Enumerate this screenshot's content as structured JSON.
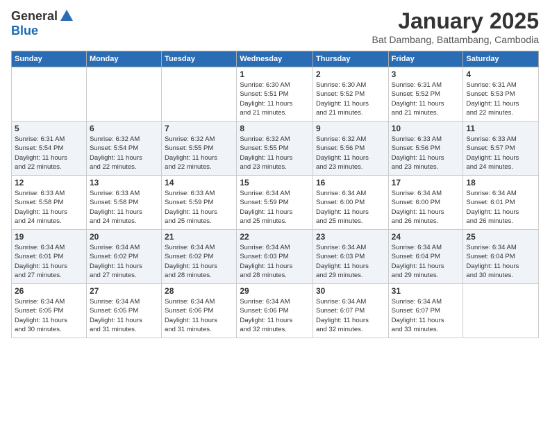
{
  "header": {
    "logo_general": "General",
    "logo_blue": "Blue",
    "month_title": "January 2025",
    "location": "Bat Dambang, Battambang, Cambodia"
  },
  "weekdays": [
    "Sunday",
    "Monday",
    "Tuesday",
    "Wednesday",
    "Thursday",
    "Friday",
    "Saturday"
  ],
  "weeks": [
    [
      {
        "day": "",
        "info": ""
      },
      {
        "day": "",
        "info": ""
      },
      {
        "day": "",
        "info": ""
      },
      {
        "day": "1",
        "info": "Sunrise: 6:30 AM\nSunset: 5:51 PM\nDaylight: 11 hours\nand 21 minutes."
      },
      {
        "day": "2",
        "info": "Sunrise: 6:30 AM\nSunset: 5:52 PM\nDaylight: 11 hours\nand 21 minutes."
      },
      {
        "day": "3",
        "info": "Sunrise: 6:31 AM\nSunset: 5:52 PM\nDaylight: 11 hours\nand 21 minutes."
      },
      {
        "day": "4",
        "info": "Sunrise: 6:31 AM\nSunset: 5:53 PM\nDaylight: 11 hours\nand 22 minutes."
      }
    ],
    [
      {
        "day": "5",
        "info": "Sunrise: 6:31 AM\nSunset: 5:54 PM\nDaylight: 11 hours\nand 22 minutes."
      },
      {
        "day": "6",
        "info": "Sunrise: 6:32 AM\nSunset: 5:54 PM\nDaylight: 11 hours\nand 22 minutes."
      },
      {
        "day": "7",
        "info": "Sunrise: 6:32 AM\nSunset: 5:55 PM\nDaylight: 11 hours\nand 22 minutes."
      },
      {
        "day": "8",
        "info": "Sunrise: 6:32 AM\nSunset: 5:55 PM\nDaylight: 11 hours\nand 23 minutes."
      },
      {
        "day": "9",
        "info": "Sunrise: 6:32 AM\nSunset: 5:56 PM\nDaylight: 11 hours\nand 23 minutes."
      },
      {
        "day": "10",
        "info": "Sunrise: 6:33 AM\nSunset: 5:56 PM\nDaylight: 11 hours\nand 23 minutes."
      },
      {
        "day": "11",
        "info": "Sunrise: 6:33 AM\nSunset: 5:57 PM\nDaylight: 11 hours\nand 24 minutes."
      }
    ],
    [
      {
        "day": "12",
        "info": "Sunrise: 6:33 AM\nSunset: 5:58 PM\nDaylight: 11 hours\nand 24 minutes."
      },
      {
        "day": "13",
        "info": "Sunrise: 6:33 AM\nSunset: 5:58 PM\nDaylight: 11 hours\nand 24 minutes."
      },
      {
        "day": "14",
        "info": "Sunrise: 6:33 AM\nSunset: 5:59 PM\nDaylight: 11 hours\nand 25 minutes."
      },
      {
        "day": "15",
        "info": "Sunrise: 6:34 AM\nSunset: 5:59 PM\nDaylight: 11 hours\nand 25 minutes."
      },
      {
        "day": "16",
        "info": "Sunrise: 6:34 AM\nSunset: 6:00 PM\nDaylight: 11 hours\nand 25 minutes."
      },
      {
        "day": "17",
        "info": "Sunrise: 6:34 AM\nSunset: 6:00 PM\nDaylight: 11 hours\nand 26 minutes."
      },
      {
        "day": "18",
        "info": "Sunrise: 6:34 AM\nSunset: 6:01 PM\nDaylight: 11 hours\nand 26 minutes."
      }
    ],
    [
      {
        "day": "19",
        "info": "Sunrise: 6:34 AM\nSunset: 6:01 PM\nDaylight: 11 hours\nand 27 minutes."
      },
      {
        "day": "20",
        "info": "Sunrise: 6:34 AM\nSunset: 6:02 PM\nDaylight: 11 hours\nand 27 minutes."
      },
      {
        "day": "21",
        "info": "Sunrise: 6:34 AM\nSunset: 6:02 PM\nDaylight: 11 hours\nand 28 minutes."
      },
      {
        "day": "22",
        "info": "Sunrise: 6:34 AM\nSunset: 6:03 PM\nDaylight: 11 hours\nand 28 minutes."
      },
      {
        "day": "23",
        "info": "Sunrise: 6:34 AM\nSunset: 6:03 PM\nDaylight: 11 hours\nand 29 minutes."
      },
      {
        "day": "24",
        "info": "Sunrise: 6:34 AM\nSunset: 6:04 PM\nDaylight: 11 hours\nand 29 minutes."
      },
      {
        "day": "25",
        "info": "Sunrise: 6:34 AM\nSunset: 6:04 PM\nDaylight: 11 hours\nand 30 minutes."
      }
    ],
    [
      {
        "day": "26",
        "info": "Sunrise: 6:34 AM\nSunset: 6:05 PM\nDaylight: 11 hours\nand 30 minutes."
      },
      {
        "day": "27",
        "info": "Sunrise: 6:34 AM\nSunset: 6:05 PM\nDaylight: 11 hours\nand 31 minutes."
      },
      {
        "day": "28",
        "info": "Sunrise: 6:34 AM\nSunset: 6:06 PM\nDaylight: 11 hours\nand 31 minutes."
      },
      {
        "day": "29",
        "info": "Sunrise: 6:34 AM\nSunset: 6:06 PM\nDaylight: 11 hours\nand 32 minutes."
      },
      {
        "day": "30",
        "info": "Sunrise: 6:34 AM\nSunset: 6:07 PM\nDaylight: 11 hours\nand 32 minutes."
      },
      {
        "day": "31",
        "info": "Sunrise: 6:34 AM\nSunset: 6:07 PM\nDaylight: 11 hours\nand 33 minutes."
      },
      {
        "day": "",
        "info": ""
      }
    ]
  ]
}
